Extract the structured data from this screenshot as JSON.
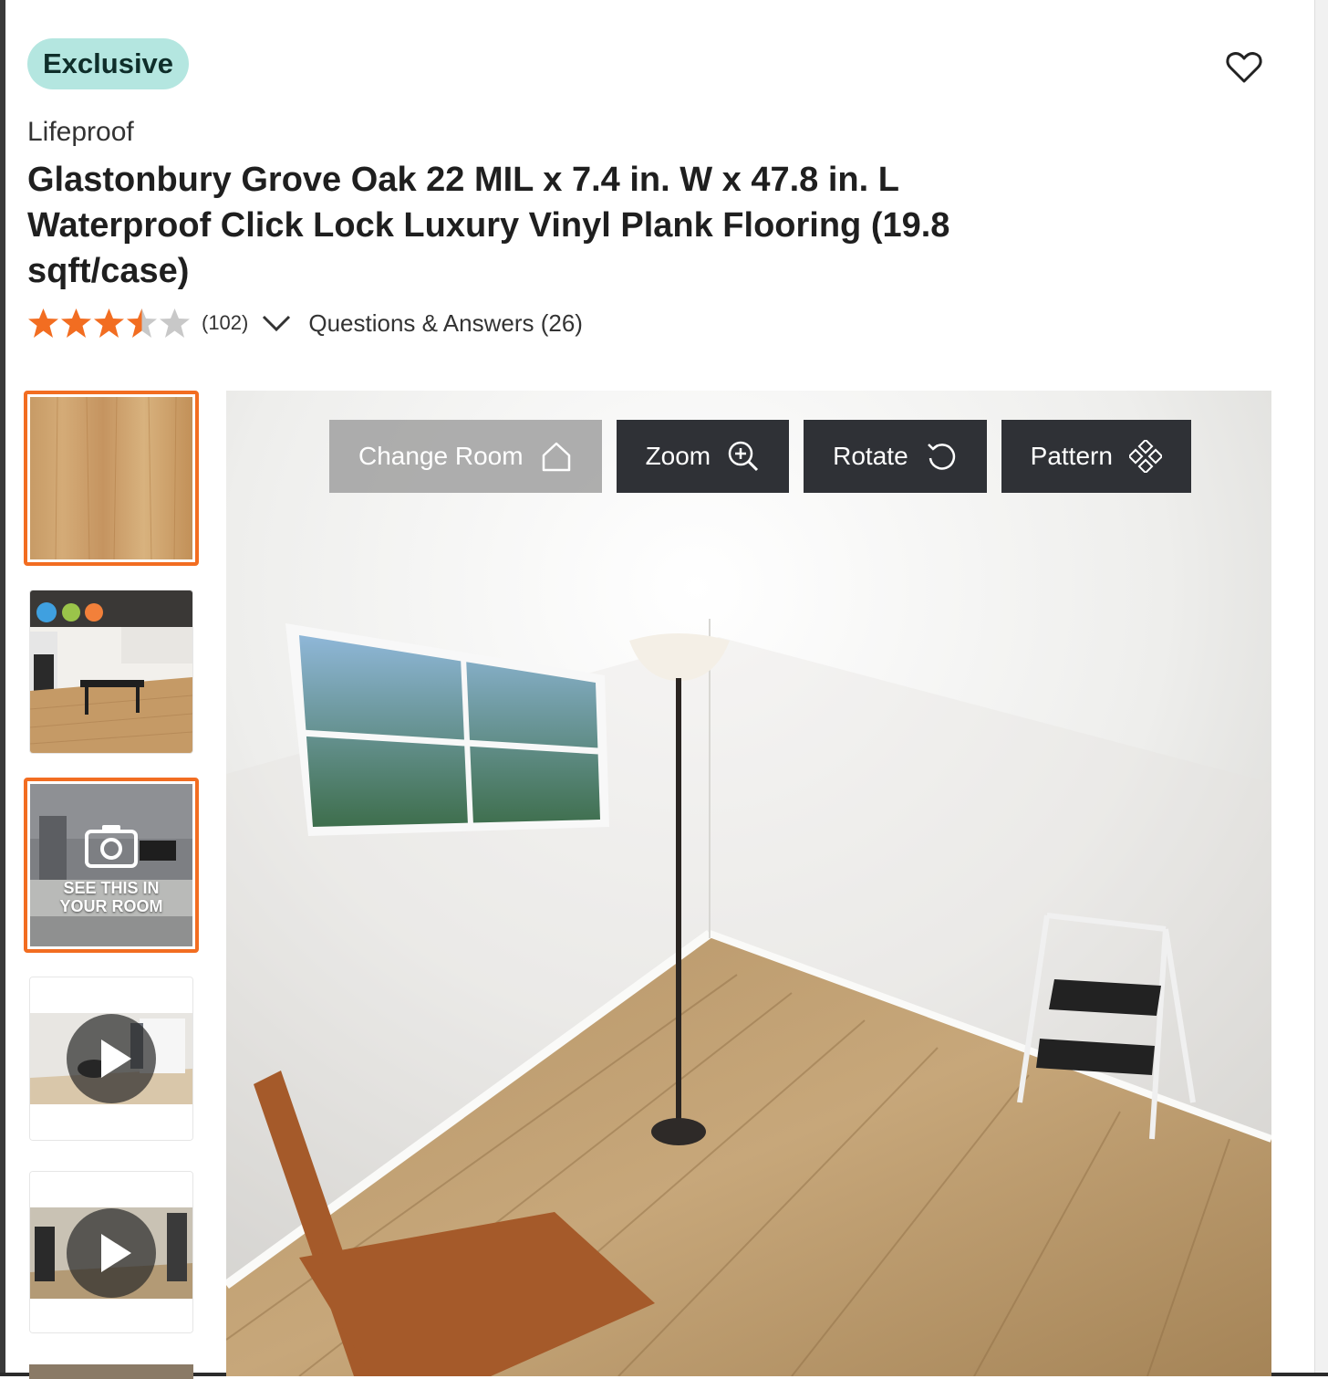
{
  "badge": {
    "label": "Exclusive"
  },
  "product": {
    "brand": "Lifeproof",
    "title": "Glastonbury Grove Oak 22 MIL x 7.4 in. W x 47.8 in. L Waterproof Click Lock Luxury Vinyl Plank Flooring (19.8 sqft/case)"
  },
  "rating": {
    "stars": 3.5,
    "max": 5,
    "count": "(102)",
    "qa": "Questions & Answers (26)"
  },
  "thumbnails": [
    {
      "kind": "wood-swatch",
      "selected": true
    },
    {
      "kind": "kitchen-photo",
      "selected": false
    },
    {
      "kind": "see-in-room",
      "selected": true,
      "label_line1": "SEE THIS IN",
      "label_line2": "YOUR ROOM"
    },
    {
      "kind": "video",
      "selected": false
    },
    {
      "kind": "video",
      "selected": false
    }
  ],
  "viewer": {
    "buttons": [
      {
        "label": "Change Room",
        "icon": "home-icon"
      },
      {
        "label": "Zoom",
        "icon": "zoom-in-icon"
      },
      {
        "label": "Rotate",
        "icon": "rotate-icon"
      },
      {
        "label": "Pattern",
        "icon": "pattern-icon"
      }
    ]
  },
  "colors": {
    "accent": "#f26d21",
    "badge_bg": "#b4e6e0",
    "star": "#f26d21",
    "star_empty": "#c8c8c8",
    "toolbar_dark": "#2f3136"
  }
}
